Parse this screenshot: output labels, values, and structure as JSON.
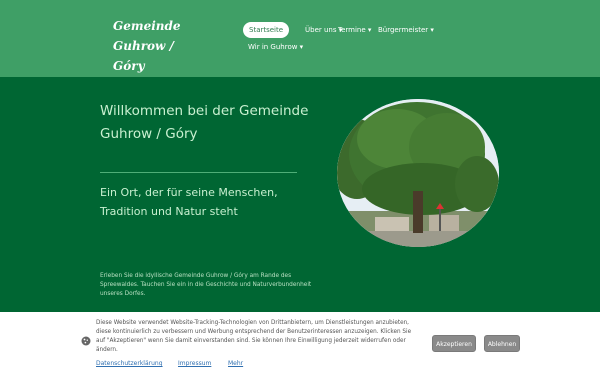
{
  "header": {
    "logo_line1": "Gemeinde Guhrow /",
    "logo_line2": "Góry",
    "nav": {
      "home": "Startseite",
      "about": "Über uns ▾",
      "events": "Termine ▾",
      "mayor": "Bürgermeister ▾",
      "wir": "Wir in Guhrow ▾"
    }
  },
  "hero": {
    "title": "Willkommen bei der Gemeinde Guhrow / Góry",
    "subtitle": "Ein Ort, der für seine Menschen, Tradition und Natur steht",
    "body": "Erleben Sie die idyllische Gemeinde Guhrow / Góry am Rande des Spreewaldes. Tauchen Sie ein in die Geschichte und Naturverbundenheit unseres Dorfes."
  },
  "cookie": {
    "text": "Diese Website verwendet Website-Tracking-Technologien von Drittanbietern, um Dienstleistungen anzubieten, diese kontinuierlich zu verbessern und Werbung entsprechend der Benutzerinteressen anzuzeigen. Klicken Sie auf \"Akzeptieren\" wenn Sie damit einverstanden sind. Sie können Ihre Einwilligung jederzeit widerrufen oder ändern.",
    "link_privacy": "Datenschutzerklärung",
    "link_imprint": "Impressum",
    "link_more": "Mehr",
    "accept": "Akzeptieren",
    "decline": "Ablehnen"
  },
  "colors": {
    "header_bg": "#3f9f66",
    "main_bg": "#006633",
    "accent_text": "#c8f0d0",
    "button_gray": "#8a8a8a",
    "link_blue": "#2f6fb0"
  },
  "icons": [
    "cookie-icon"
  ]
}
